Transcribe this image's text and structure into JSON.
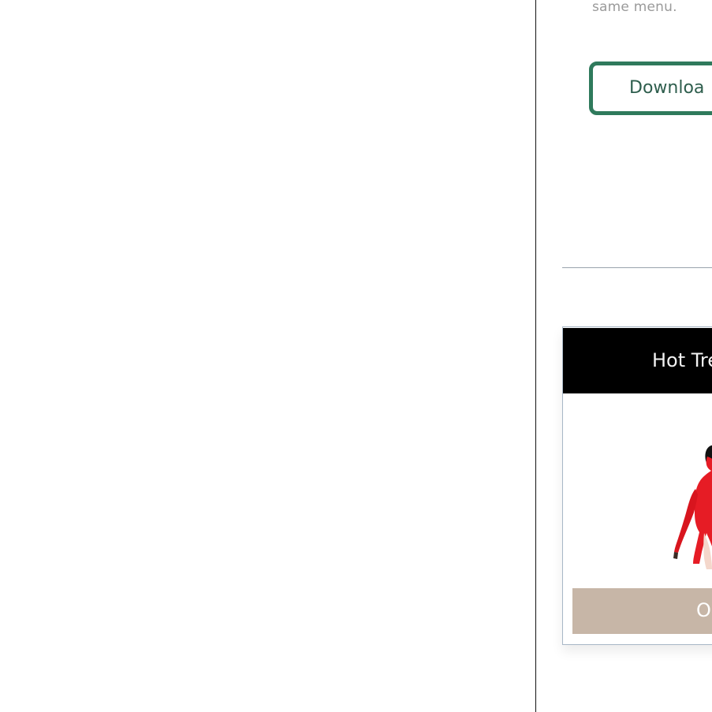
{
  "content": {
    "note_text": "same menu.",
    "download_button_label": "Downloa"
  },
  "promo_card": {
    "title": "Hot Tre",
    "order_button_label": "Ord"
  },
  "icons": {
    "product_image": "woman-in-red-dress-image"
  },
  "colors": {
    "button_border": "#2f7a5c",
    "button_text": "#2e5e4d",
    "promo_header_bg": "#000000",
    "order_button_bg": "#c7b6a7"
  }
}
